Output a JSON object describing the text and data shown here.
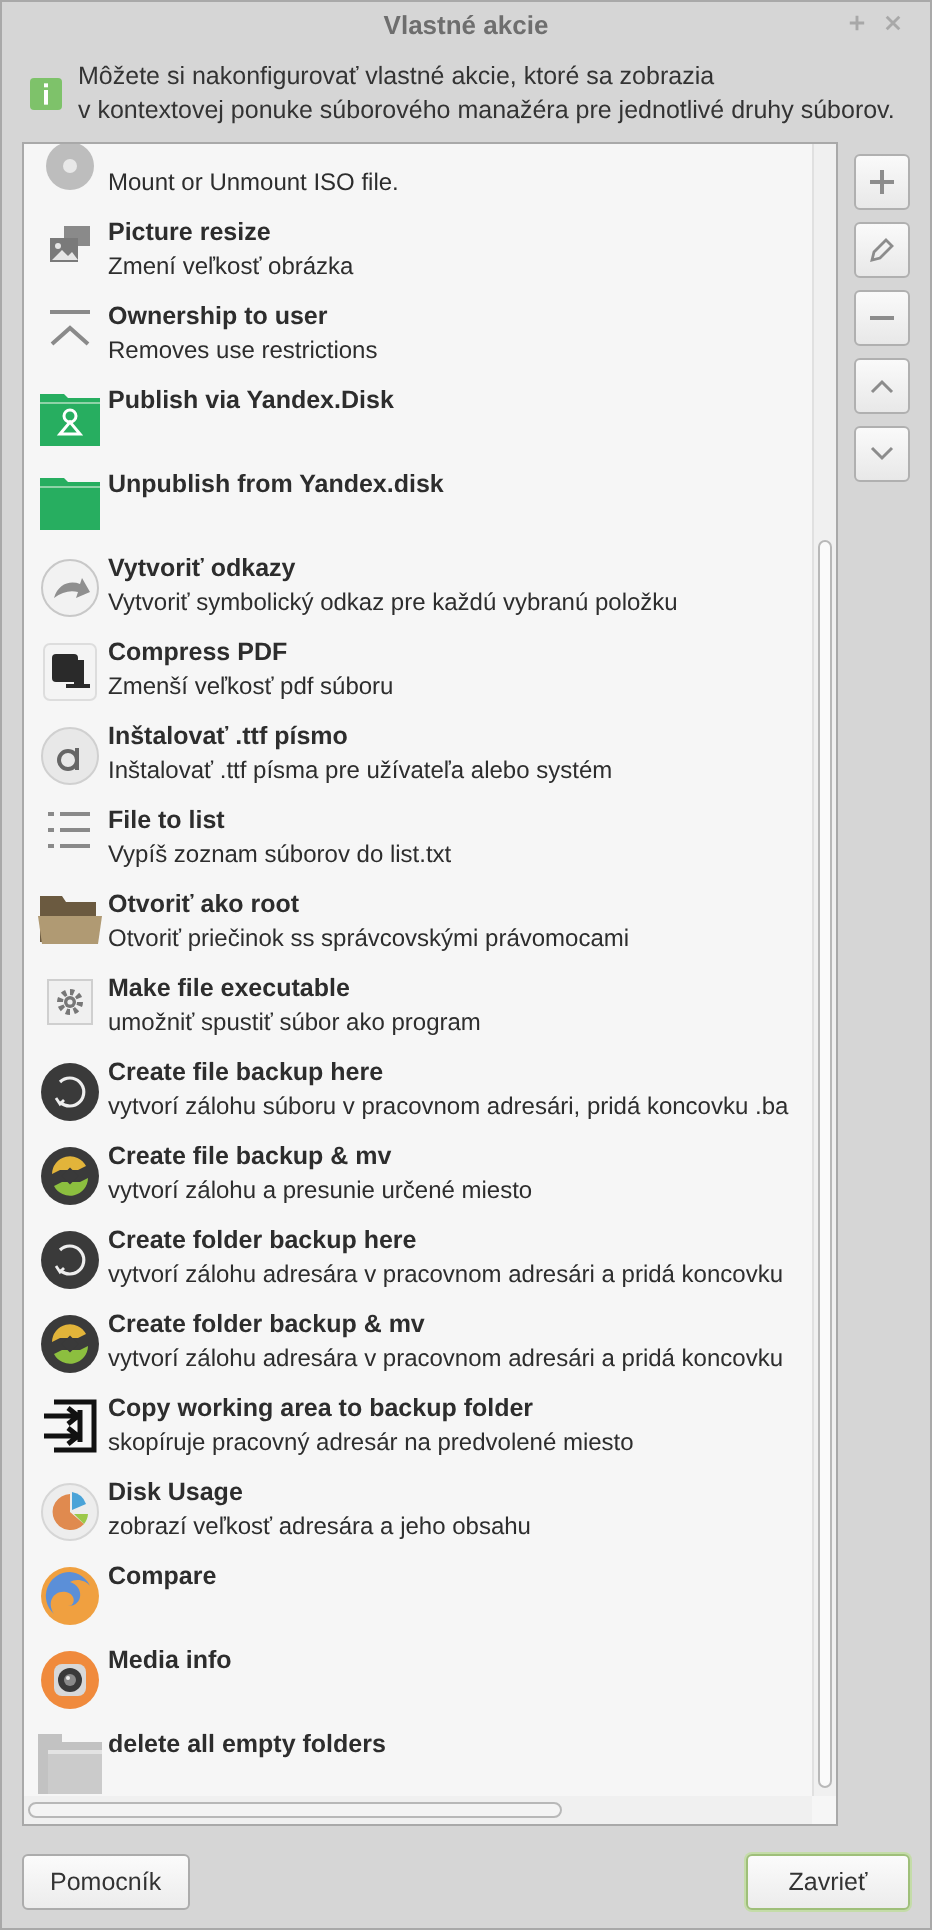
{
  "window": {
    "title": "Vlastné akcie"
  },
  "info": {
    "text": "Môžete si nakonfigurovať vlastné akcie, ktoré sa zobrazia\nv kontextovej ponuke súborového manažéra pre jednotlivé druhy súborov."
  },
  "actions": [
    {
      "description": "Mount or Unmount ISO file."
    },
    {
      "title": "Picture resize",
      "description": "Zmení veľkosť obrázka"
    },
    {
      "title": "Ownership to user",
      "description": "Removes use restrictions"
    },
    {
      "title": "Publish via Yandex.Disk"
    },
    {
      "title": "Unpublish from Yandex.disk"
    },
    {
      "title": "Vytvoriť odkazy",
      "description": "Vytvoriť symbolický odkaz pre každú vybranú položku"
    },
    {
      "title": "Compress PDF",
      "description": "Zmenší veľkosť pdf súboru"
    },
    {
      "title": "Inštalovať .ttf písmo",
      "description": "Inštalovať .ttf písma pre užívateľa alebo systém"
    },
    {
      "title": "File to list",
      "description": "Vypíš zoznam súborov do list.txt"
    },
    {
      "title": "Otvoriť ako root",
      "description": "Otvoriť priečinok ss správcovskými právomocami"
    },
    {
      "title": "Make file executable",
      "description": "umožniť spustiť súbor ako program"
    },
    {
      "title": "Create file backup here",
      "description": "vytvorí zálohu súboru v pracovnom adresári, pridá koncovku .ba"
    },
    {
      "title": "Create file backup & mv",
      "description": "vytvorí zálohu a presunie určené miesto"
    },
    {
      "title": "Create folder backup here",
      "description": "vytvorí zálohu adresára v pracovnom adresári a pridá koncovku"
    },
    {
      "title": "Create folder backup & mv",
      "description": "vytvorí zálohu adresára v pracovnom adresári a pridá koncovku"
    },
    {
      "title": "Copy working area to backup folder",
      "description": "skopíruje pracovný adresár na predvolené miesto"
    },
    {
      "title": "Disk Usage",
      "description": "zobrazí veľkosť adresára a jeho obsahu"
    },
    {
      "title": "Compare"
    },
    {
      "title": "Media info"
    },
    {
      "title": "delete all empty folders"
    }
  ],
  "buttons": {
    "help": "Pomocník",
    "close": "Zavrieť"
  }
}
